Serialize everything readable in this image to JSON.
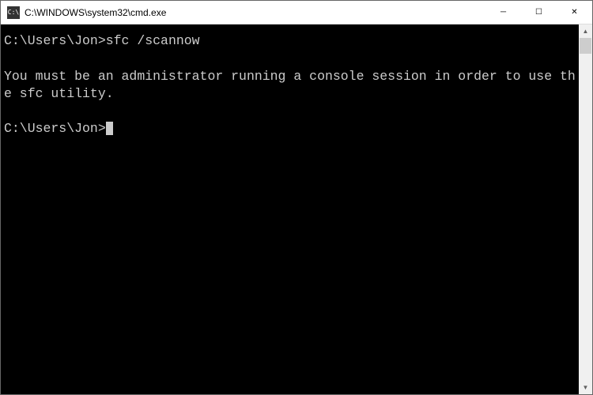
{
  "window": {
    "icon_text": "C:\\",
    "title": "C:\\WINDOWS\\system32\\cmd.exe"
  },
  "terminal": {
    "lines": [
      {
        "prompt": "C:\\Users\\Jon>",
        "command": "sfc /scannow"
      },
      {
        "blank": true
      },
      {
        "text": "You must be an administrator running a console session in order to use the sfc utility."
      },
      {
        "blank": true
      },
      {
        "prompt": "C:\\Users\\Jon>",
        "cursor": true
      }
    ]
  },
  "controls": {
    "minimize": "─",
    "maximize": "☐",
    "close": "✕"
  },
  "scrollbar": {
    "up": "▲",
    "down": "▼"
  }
}
